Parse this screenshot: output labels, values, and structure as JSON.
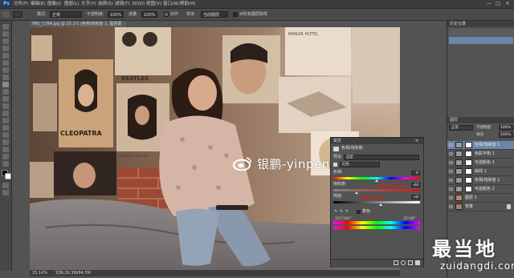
{
  "app": {
    "logo": "Ps",
    "menu": [
      "文件(F)",
      "编辑(E)",
      "图像(I)",
      "图层(L)",
      "文字(Y)",
      "选择(S)",
      "滤镜(T)",
      "3D(D)",
      "视图(V)",
      "窗口(W)",
      "帮助(H)"
    ],
    "window_controls": [
      "—",
      "□",
      "✕"
    ]
  },
  "options_bar": {
    "mode_label": "模式:",
    "mode_value": "正常",
    "opacity_label": "不透明度:",
    "opacity_value": "100%",
    "flow_label": "流量:",
    "flow_value": "100%",
    "sample_all_label": "对所有图层取样",
    "aligned_label": "对齐",
    "sample_label": "样本:",
    "sample_value": "当前图层"
  },
  "document": {
    "tab_title": "IMG_1784.jpg @ 25.1% (色相/饱和度 1, 图层蒙版/8) *",
    "zoom": "25.14%",
    "doc_info": "文档:26.3M/84.5M",
    "watermark": "银鹏-yinpeng",
    "posters": {
      "beatles": "BEATLES",
      "cleopatra": "CLEOPATRA",
      "vanessa": "VANESSA TEXTURE",
      "manor": "MANOR HOTEL"
    }
  },
  "properties_panel": {
    "title": "属性",
    "subtitle": "色相/饱和度",
    "preset_label": "预设:",
    "preset_value": "自定",
    "channel_value": "红色",
    "hue_label": "色相:",
    "hue_value": "0",
    "saturation_label": "饱和度:",
    "saturation_value": "-44",
    "lightness_label": "明度:",
    "lightness_value": "+8",
    "colorize_label": "着色",
    "range_left": "315°/345°",
    "range_right": "15°\\45°",
    "arrow_color": "#d21f1f"
  },
  "right_panels": {
    "history_title": "历史记录",
    "layers_title": "图层",
    "blend_mode": "正常",
    "opacity_label": "不透明度:",
    "opacity_value": "100%",
    "fill_label": "填充:",
    "fill_value": "100%",
    "layers": [
      {
        "name": "色相/饱和度 1",
        "selected": true
      },
      {
        "name": "色彩平衡 1",
        "selected": false
      },
      {
        "name": "可选颜色 1",
        "selected": false
      },
      {
        "name": "曲线 1",
        "selected": false
      },
      {
        "name": "色相/饱和度 2",
        "selected": false
      },
      {
        "name": "可选颜色 2",
        "selected": false
      },
      {
        "name": "图层 1",
        "selected": false
      },
      {
        "name": "背景",
        "selected": false
      }
    ]
  },
  "branding": {
    "corner_logo": "最当地",
    "corner_url": "zuidangdi.com"
  }
}
